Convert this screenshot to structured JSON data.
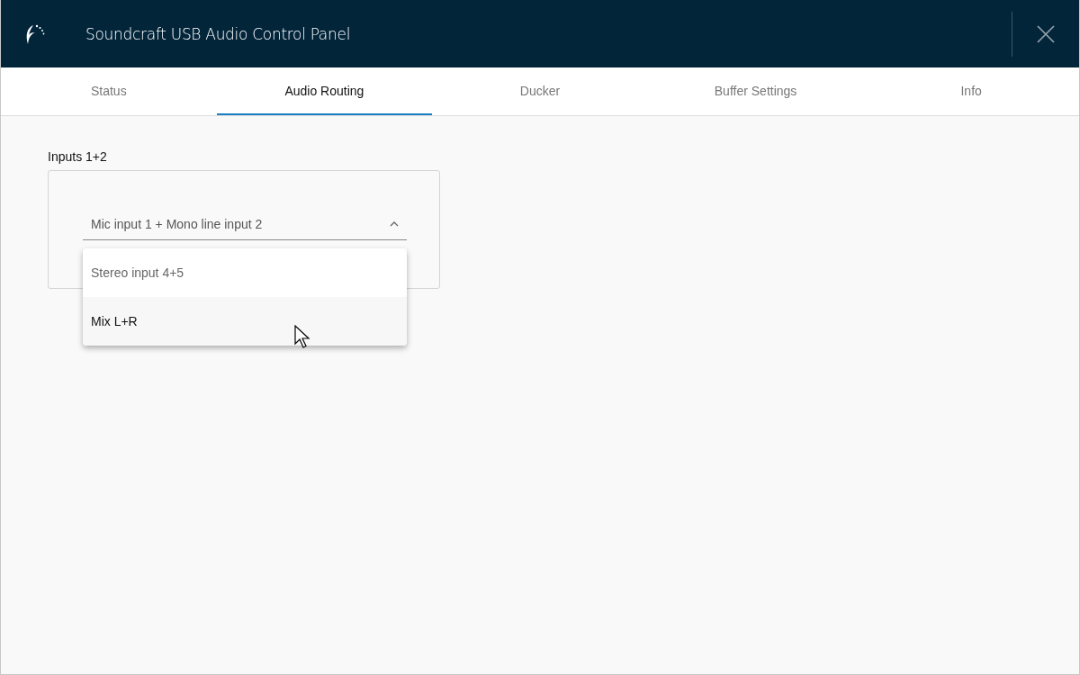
{
  "window": {
    "title": "Soundcraft USB Audio Control Panel"
  },
  "tabs": [
    {
      "label": "Status",
      "selected": false
    },
    {
      "label": "Audio Routing",
      "selected": true
    },
    {
      "label": "Ducker",
      "selected": false
    },
    {
      "label": "Buffer Settings",
      "selected": false
    },
    {
      "label": "Info",
      "selected": false
    }
  ],
  "routing": {
    "group_label": "Inputs 1+2",
    "dropdown": {
      "value": "Mic input 1 + Mono line input 2",
      "expanded": true,
      "options": [
        {
          "label": "Stereo input 4+5",
          "hovered": false
        },
        {
          "label": "Mix L+R",
          "hovered": true
        }
      ]
    }
  }
}
